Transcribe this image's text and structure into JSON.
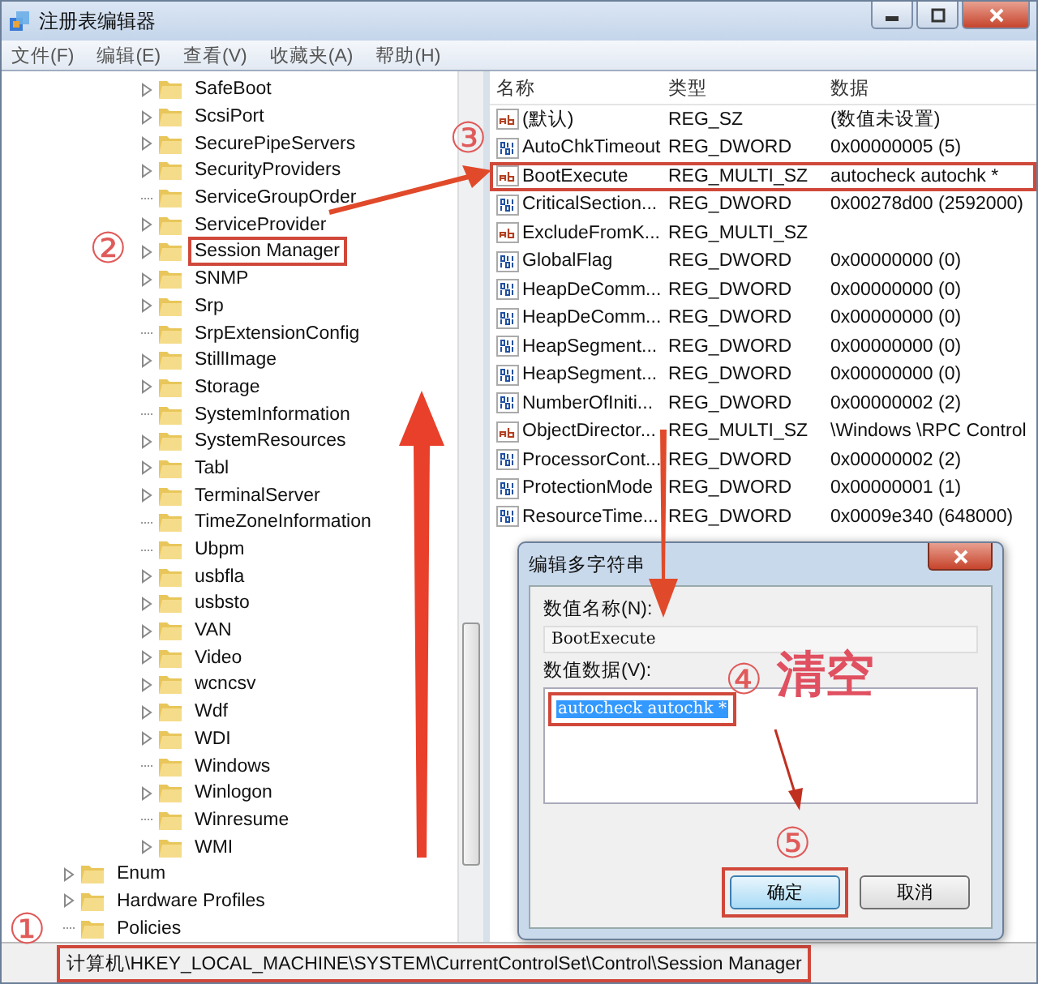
{
  "window": {
    "title": "注册表编辑器"
  },
  "menu": [
    {
      "label": "文件(F)"
    },
    {
      "label": "编辑(E)"
    },
    {
      "label": "查看(V)"
    },
    {
      "label": "收藏夹(A)"
    },
    {
      "label": "帮助(H)"
    }
  ],
  "tree": [
    {
      "children": [
        {
          "label": "SafeBoot",
          "expandable": true,
          "highlighted": false
        },
        {
          "label": "ScsiPort",
          "expandable": true,
          "highlighted": false
        },
        {
          "label": "SecurePipeServers",
          "expandable": true,
          "highlighted": false
        },
        {
          "label": "SecurityProviders",
          "expandable": true,
          "highlighted": false
        },
        {
          "label": "ServiceGroupOrder",
          "expandable": false,
          "highlighted": false
        },
        {
          "label": "ServiceProvider",
          "expandable": true,
          "highlighted": false
        },
        {
          "label": "Session Manager",
          "expandable": true,
          "highlighted": true
        },
        {
          "label": "SNMP",
          "expandable": true,
          "highlighted": false
        },
        {
          "label": "Srp",
          "expandable": true,
          "highlighted": false
        },
        {
          "label": "SrpExtensionConfig",
          "expandable": false,
          "highlighted": false
        },
        {
          "label": "StillImage",
          "expandable": true,
          "highlighted": false
        },
        {
          "label": "Storage",
          "expandable": true,
          "highlighted": false
        },
        {
          "label": "SystemInformation",
          "expandable": false,
          "highlighted": false
        },
        {
          "label": "SystemResources",
          "expandable": true,
          "highlighted": false
        },
        {
          "label": "Tabl",
          "expandable": true,
          "highlighted": false
        },
        {
          "label": "TerminalServer",
          "expandable": true,
          "highlighted": false
        },
        {
          "label": "TimeZoneInformation",
          "expandable": false,
          "highlighted": false
        },
        {
          "label": "Ubpm",
          "expandable": false,
          "highlighted": false
        },
        {
          "label": "usbfla",
          "expandable": true,
          "highlighted": false
        },
        {
          "label": "usbsto",
          "expandable": true,
          "highlighted": false
        },
        {
          "label": "VAN",
          "expandable": true,
          "highlighted": false
        },
        {
          "label": "Video",
          "expandable": true,
          "highlighted": false
        },
        {
          "label": "wcncsv",
          "expandable": true,
          "highlighted": false
        },
        {
          "label": "Wdf",
          "expandable": true,
          "highlighted": false
        },
        {
          "label": "WDI",
          "expandable": true,
          "highlighted": false
        },
        {
          "label": "Windows",
          "expandable": false,
          "highlighted": false
        },
        {
          "label": "Winlogon",
          "expandable": true,
          "highlighted": false
        },
        {
          "label": "Winresume",
          "expandable": false,
          "highlighted": false
        },
        {
          "label": "WMI",
          "expandable": true,
          "highlighted": false
        }
      ]
    },
    {
      "label": "Enum",
      "expandable": true,
      "highlighted": false
    },
    {
      "label": "Hardware Profiles",
      "expandable": true,
      "highlighted": false
    },
    {
      "label": "Policies",
      "expandable": false,
      "highlighted": false
    }
  ],
  "table": {
    "columns": [
      "名称",
      "类型",
      "数据"
    ],
    "rows": [
      {
        "kind": "string",
        "name": "(默认)",
        "type": "REG_SZ",
        "data": "(数值未设置)",
        "highlighted": false
      },
      {
        "kind": "binary",
        "name": "AutoChkTimeout",
        "type": "REG_DWORD",
        "data": "0x00000005 (5)",
        "highlighted": false
      },
      {
        "kind": "string",
        "name": "BootExecute",
        "type": "REG_MULTI_SZ",
        "data": "autocheck autochk *",
        "highlighted": true
      },
      {
        "kind": "binary",
        "name": "CriticalSection...",
        "type": "REG_DWORD",
        "data": "0x00278d00 (2592000)",
        "highlighted": false
      },
      {
        "kind": "string",
        "name": "ExcludeFromK...",
        "type": "REG_MULTI_SZ",
        "highlighted": false
      },
      {
        "kind": "binary",
        "name": "GlobalFlag",
        "type": "REG_DWORD",
        "data": "0x00000000 (0)",
        "highlighted": false
      },
      {
        "kind": "binary",
        "name": "HeapDeComm...",
        "type": "REG_DWORD",
        "data": "0x00000000 (0)",
        "highlighted": false
      },
      {
        "kind": "binary",
        "name": "HeapDeComm...",
        "type": "REG_DWORD",
        "data": "0x00000000 (0)",
        "highlighted": false
      },
      {
        "kind": "binary",
        "name": "HeapSegment...",
        "type": "REG_DWORD",
        "data": "0x00000000 (0)",
        "highlighted": false
      },
      {
        "kind": "binary",
        "name": "HeapSegment...",
        "type": "REG_DWORD",
        "data": "0x00000000 (0)",
        "highlighted": false
      },
      {
        "kind": "binary",
        "name": "NumberOfIniti...",
        "type": "REG_DWORD",
        "data": "0x00000002 (2)",
        "highlighted": false
      },
      {
        "kind": "string",
        "name": "ObjectDirector...",
        "type": "REG_MULTI_SZ",
        "data": "\\Windows \\RPC Control",
        "highlighted": false
      },
      {
        "kind": "binary",
        "name": "ProcessorCont...",
        "type": "REG_DWORD",
        "data": "0x00000002 (2)",
        "highlighted": false
      },
      {
        "kind": "binary",
        "name": "ProtectionMode",
        "type": "REG_DWORD",
        "data": "0x00000001 (1)",
        "highlighted": false
      },
      {
        "kind": "binary",
        "name": "ResourceTime...",
        "type": "REG_DWORD",
        "data": "0x0009e340 (648000)",
        "highlighted": false
      }
    ]
  },
  "dialog": {
    "title": "编辑多字符串",
    "name_label": "数值名称(N):",
    "name_value": "BootExecute",
    "data_label": "数值数据(V):",
    "data_value": "autocheck autochk *",
    "data_selected": true,
    "data_highlighted": true,
    "buttons": [
      {
        "label": "确定",
        "default": true,
        "highlighted": true
      },
      {
        "label": "取消",
        "default": false,
        "highlighted": false
      }
    ]
  },
  "status_bar": {
    "path": "计算机\\HKEY_LOCAL_MACHINE\\SYSTEM\\CurrentControlSet\\Control\\Session Manager",
    "highlighted": true
  },
  "annotations": [
    {
      "kind": "step",
      "text": "①"
    },
    {
      "kind": "step",
      "text": "②"
    },
    {
      "kind": "step",
      "text": "③"
    },
    {
      "kind": "step",
      "text": "④"
    },
    {
      "kind": "note",
      "text": "清空"
    },
    {
      "kind": "step",
      "text": "⑤"
    }
  ]
}
